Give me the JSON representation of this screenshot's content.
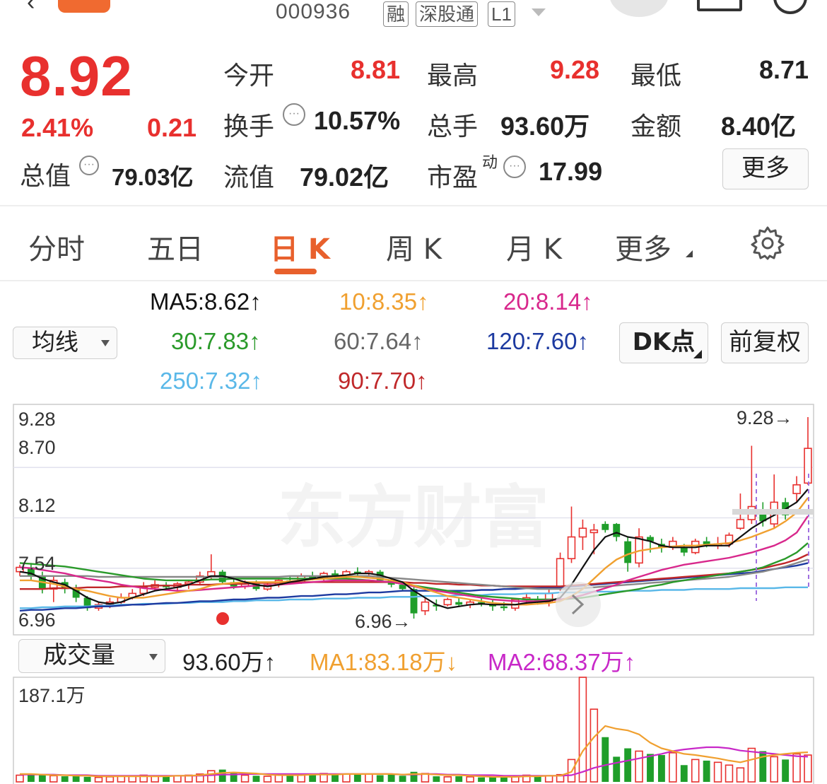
{
  "header": {
    "code": "000936",
    "tags": [
      "融",
      "深股通",
      "L1"
    ]
  },
  "quote": {
    "price": "8.92",
    "change_pct": "2.41%",
    "change_amt": "0.21",
    "total_value_label": "总值",
    "total_value": "79.03亿",
    "rows": [
      [
        {
          "label": "今开",
          "value": "8.81",
          "color": "red"
        },
        {
          "label": "最高",
          "value": "9.28",
          "color": "red"
        },
        {
          "label": "最低",
          "value": "8.71",
          "color": "black"
        }
      ],
      [
        {
          "label": "换手",
          "value": "10.57%",
          "color": "black"
        },
        {
          "label": "总手",
          "value": "93.60万",
          "color": "black"
        },
        {
          "label": "金额",
          "value": "8.40亿",
          "color": "black"
        }
      ],
      [
        {
          "label": "流值",
          "value": "79.02亿",
          "color": "black"
        },
        {
          "label": "市盈",
          "sup": "动",
          "value": "17.99",
          "color": "black"
        }
      ]
    ],
    "more_button": "更多"
  },
  "tabs": [
    "分时",
    "五日",
    "日 K",
    "周 K",
    "月 K",
    "更多"
  ],
  "active_tab": 2,
  "ma_controls": {
    "selector": "均线",
    "dk_button": "DK点",
    "adjust_button": "前复权",
    "items": [
      {
        "text": "MA5:8.62",
        "arrow": "↑",
        "color": "#111111"
      },
      {
        "text": "10:8.35",
        "arrow": "↑",
        "color": "#f0a030"
      },
      {
        "text": "20:8.14",
        "arrow": "↑",
        "color": "#d8288c"
      },
      {
        "text": "30:7.83",
        "arrow": "↑",
        "color": "#2a9a2a"
      },
      {
        "text": "60:7.64",
        "arrow": "↑",
        "color": "#666666"
      },
      {
        "text": "120:7.60",
        "arrow": "↑",
        "color": "#1d3aa0"
      },
      {
        "text": "250:7.32",
        "arrow": "↑",
        "color": "#5ab8e8"
      },
      {
        "text": "90:7.70",
        "arrow": "↑",
        "color": "#c0282a"
      }
    ]
  },
  "kline": {
    "y_labels": [
      "9.28",
      "8.70",
      "8.12",
      "7.54",
      "6.96"
    ],
    "max_annotation": "9.28→",
    "min_annotation": "6.96→",
    "watermark": "东方财富"
  },
  "volume": {
    "selector": "成交量",
    "current": "93.60万",
    "current_arrow": "↑",
    "ma1": "MA1:83.18万",
    "ma1_arrow": "↓",
    "ma2": "MA2:68.37万",
    "ma2_arrow": "↑",
    "max_label": "187.1万",
    "colors": {
      "ma1": "#f0a030",
      "ma2": "#c828c8"
    }
  },
  "chart_data": {
    "type": "candlestick",
    "y_range": [
      6.96,
      9.28
    ],
    "candles": [
      [
        7.5,
        7.58,
        7.45,
        7.55
      ],
      [
        7.55,
        7.6,
        7.4,
        7.45
      ],
      [
        7.45,
        7.5,
        7.25,
        7.3
      ],
      [
        7.3,
        7.45,
        7.15,
        7.4
      ],
      [
        7.38,
        7.42,
        7.25,
        7.3
      ],
      [
        7.3,
        7.35,
        7.15,
        7.2
      ],
      [
        7.2,
        7.22,
        7.05,
        7.08
      ],
      [
        7.08,
        7.15,
        7.05,
        7.12
      ],
      [
        7.12,
        7.2,
        7.08,
        7.15
      ],
      [
        7.15,
        7.25,
        7.12,
        7.2
      ],
      [
        7.2,
        7.3,
        7.18,
        7.25
      ],
      [
        7.25,
        7.38,
        7.22,
        7.32
      ],
      [
        7.32,
        7.4,
        7.28,
        7.35
      ],
      [
        7.35,
        7.38,
        7.3,
        7.32
      ],
      [
        7.32,
        7.38,
        7.28,
        7.36
      ],
      [
        7.36,
        7.4,
        7.3,
        7.38
      ],
      [
        7.38,
        7.5,
        7.35,
        7.45
      ],
      [
        7.45,
        7.7,
        7.42,
        7.5
      ],
      [
        7.5,
        7.52,
        7.35,
        7.38
      ],
      [
        7.38,
        7.42,
        7.3,
        7.33
      ],
      [
        7.33,
        7.4,
        7.3,
        7.36
      ],
      [
        7.36,
        7.4,
        7.28,
        7.3
      ],
      [
        7.3,
        7.38,
        7.28,
        7.35
      ],
      [
        7.35,
        7.42,
        7.32,
        7.4
      ],
      [
        7.4,
        7.45,
        7.35,
        7.38
      ],
      [
        7.38,
        7.48,
        7.36,
        7.45
      ],
      [
        7.45,
        7.5,
        7.4,
        7.42
      ],
      [
        7.42,
        7.5,
        7.4,
        7.48
      ],
      [
        7.48,
        7.52,
        7.42,
        7.45
      ],
      [
        7.45,
        7.52,
        7.42,
        7.5
      ],
      [
        7.5,
        7.55,
        7.45,
        7.48
      ],
      [
        7.48,
        7.52,
        7.45,
        7.5
      ],
      [
        7.5,
        7.52,
        7.38,
        7.4
      ],
      [
        7.4,
        7.42,
        7.32,
        7.35
      ],
      [
        7.35,
        7.38,
        7.28,
        7.3
      ],
      [
        7.3,
        7.32,
        6.96,
        7.02
      ],
      [
        7.05,
        7.2,
        7.0,
        7.15
      ],
      [
        7.12,
        7.18,
        7.05,
        7.1
      ],
      [
        7.12,
        7.2,
        7.1,
        7.18
      ],
      [
        7.15,
        7.2,
        7.1,
        7.12
      ],
      [
        7.12,
        7.18,
        7.08,
        7.15
      ],
      [
        7.15,
        7.2,
        7.1,
        7.12
      ],
      [
        7.12,
        7.18,
        7.05,
        7.1
      ],
      [
        7.1,
        7.15,
        7.05,
        7.08
      ],
      [
        7.08,
        7.2,
        7.05,
        7.18
      ],
      [
        7.18,
        7.25,
        7.12,
        7.2
      ],
      [
        7.18,
        7.22,
        7.12,
        7.15
      ],
      [
        7.15,
        7.3,
        7.1,
        7.25
      ],
      [
        7.3,
        7.72,
        7.28,
        7.65
      ],
      [
        7.65,
        8.25,
        7.6,
        7.9
      ],
      [
        7.9,
        8.1,
        7.75,
        8.0
      ],
      [
        7.95,
        8.05,
        7.7,
        7.98
      ],
      [
        8.05,
        8.08,
        7.95,
        7.98
      ],
      [
        8.05,
        8.06,
        7.85,
        7.9
      ],
      [
        7.85,
        7.9,
        7.5,
        7.6
      ],
      [
        7.6,
        8.0,
        7.55,
        7.9
      ],
      [
        7.9,
        7.92,
        7.72,
        7.85
      ],
      [
        7.82,
        7.88,
        7.72,
        7.78
      ],
      [
        7.78,
        7.9,
        7.75,
        7.85
      ],
      [
        7.78,
        7.82,
        7.68,
        7.72
      ],
      [
        7.72,
        7.88,
        7.7,
        7.85
      ],
      [
        7.85,
        7.9,
        7.78,
        7.8
      ],
      [
        7.8,
        7.9,
        7.76,
        7.82
      ],
      [
        7.82,
        7.95,
        7.78,
        7.92
      ],
      [
        8.0,
        8.4,
        7.98,
        8.1
      ],
      [
        8.1,
        8.95,
        8.05,
        8.25
      ],
      [
        8.18,
        8.3,
        8.02,
        8.08
      ],
      [
        8.05,
        8.62,
        8.0,
        8.3
      ],
      [
        8.3,
        8.35,
        8.1,
        8.15
      ],
      [
        8.4,
        8.6,
        8.3,
        8.5
      ],
      [
        8.52,
        9.28,
        8.5,
        8.92
      ]
    ],
    "ma5": [
      7.5,
      7.48,
      7.42,
      7.38,
      7.35,
      7.28,
      7.2,
      7.15,
      7.13,
      7.15,
      7.2,
      7.24,
      7.28,
      7.3,
      7.32,
      7.35,
      7.4,
      7.45,
      7.45,
      7.42,
      7.38,
      7.35,
      7.33,
      7.35,
      7.38,
      7.4,
      7.42,
      7.44,
      7.45,
      7.46,
      7.48,
      7.48,
      7.46,
      7.42,
      7.38,
      7.28,
      7.2,
      7.12,
      7.08,
      7.1,
      7.12,
      7.13,
      7.12,
      7.12,
      7.12,
      7.14,
      7.15,
      7.16,
      7.2,
      7.35,
      7.55,
      7.75,
      7.9,
      7.95,
      7.9,
      7.88,
      7.85,
      7.8,
      7.78,
      7.78,
      7.78,
      7.8,
      7.8,
      7.8,
      7.9,
      8.0,
      8.08,
      8.15,
      8.22,
      8.3,
      8.45
    ],
    "ma10": [
      7.4,
      7.4,
      7.38,
      7.36,
      7.33,
      7.3,
      7.28,
      7.25,
      7.22,
      7.2,
      7.2,
      7.2,
      7.22,
      7.24,
      7.26,
      7.28,
      7.3,
      7.34,
      7.36,
      7.37,
      7.38,
      7.38,
      7.38,
      7.38,
      7.39,
      7.4,
      7.41,
      7.42,
      7.43,
      7.44,
      7.44,
      7.43,
      7.42,
      7.4,
      7.38,
      7.34,
      7.3,
      7.26,
      7.22,
      7.2,
      7.18,
      7.16,
      7.14,
      7.13,
      7.12,
      7.12,
      7.13,
      7.14,
      7.16,
      7.22,
      7.3,
      7.42,
      7.54,
      7.64,
      7.7,
      7.74,
      7.76,
      7.78,
      7.79,
      7.8,
      7.8,
      7.81,
      7.82,
      7.83,
      7.86,
      7.9,
      7.95,
      8.0,
      8.08,
      8.18,
      8.35
    ],
    "ma20": [
      7.55,
      7.54,
      7.52,
      7.5,
      7.48,
      7.45,
      7.42,
      7.4,
      7.38,
      7.35,
      7.33,
      7.31,
      7.3,
      7.29,
      7.28,
      7.28,
      7.29,
      7.3,
      7.31,
      7.32,
      7.33,
      7.34,
      7.34,
      7.35,
      7.36,
      7.37,
      7.38,
      7.39,
      7.4,
      7.4,
      7.4,
      7.4,
      7.39,
      7.38,
      7.36,
      7.33,
      7.3,
      7.28,
      7.26,
      7.24,
      7.22,
      7.2,
      7.18,
      7.17,
      7.16,
      7.16,
      7.16,
      7.17,
      7.18,
      7.2,
      7.23,
      7.27,
      7.31,
      7.35,
      7.4,
      7.44,
      7.48,
      7.52,
      7.55,
      7.58,
      7.6,
      7.62,
      7.64,
      7.66,
      7.69,
      7.72,
      7.76,
      7.8,
      7.86,
      7.95,
      8.14
    ],
    "ma30": [
      7.6,
      7.59,
      7.58,
      7.57,
      7.56,
      7.54,
      7.52,
      7.5,
      7.48,
      7.46,
      7.44,
      7.42,
      7.41,
      7.4,
      7.4,
      7.4,
      7.4,
      7.41,
      7.41,
      7.42,
      7.42,
      7.42,
      7.42,
      7.42,
      7.42,
      7.42,
      7.42,
      7.42,
      7.42,
      7.42,
      7.41,
      7.4,
      7.39,
      7.38,
      7.36,
      7.34,
      7.32,
      7.3,
      7.28,
      7.26,
      7.24,
      7.22,
      7.21,
      7.2,
      7.19,
      7.18,
      7.18,
      7.18,
      7.18,
      7.19,
      7.2,
      7.22,
      7.24,
      7.26,
      7.28,
      7.3,
      7.33,
      7.35,
      7.38,
      7.4,
      7.42,
      7.44,
      7.46,
      7.48,
      7.5,
      7.52,
      7.55,
      7.6,
      7.65,
      7.72,
      7.83
    ],
    "ma60": [
      7.45,
      7.45,
      7.45,
      7.45,
      7.45,
      7.45,
      7.45,
      7.44,
      7.44,
      7.44,
      7.44,
      7.44,
      7.44,
      7.44,
      7.44,
      7.44,
      7.44,
      7.44,
      7.44,
      7.44,
      7.44,
      7.44,
      7.44,
      7.44,
      7.45,
      7.45,
      7.45,
      7.45,
      7.45,
      7.45,
      7.45,
      7.45,
      7.44,
      7.43,
      7.42,
      7.41,
      7.4,
      7.39,
      7.38,
      7.37,
      7.36,
      7.35,
      7.34,
      7.33,
      7.32,
      7.31,
      7.3,
      7.3,
      7.3,
      7.3,
      7.31,
      7.32,
      7.33,
      7.34,
      7.35,
      7.36,
      7.37,
      7.38,
      7.39,
      7.4,
      7.41,
      7.42,
      7.43,
      7.44,
      7.46,
      7.48,
      7.5,
      7.53,
      7.56,
      7.6,
      7.64
    ],
    "ma90": [
      7.3,
      7.3,
      7.3,
      7.31,
      7.31,
      7.31,
      7.32,
      7.32,
      7.32,
      7.33,
      7.33,
      7.33,
      7.34,
      7.34,
      7.34,
      7.35,
      7.35,
      7.35,
      7.36,
      7.36,
      7.36,
      7.37,
      7.37,
      7.37,
      7.38,
      7.38,
      7.38,
      7.38,
      7.38,
      7.38,
      7.38,
      7.38,
      7.38,
      7.38,
      7.38,
      7.37,
      7.37,
      7.36,
      7.36,
      7.35,
      7.35,
      7.34,
      7.34,
      7.33,
      7.33,
      7.33,
      7.33,
      7.33,
      7.33,
      7.34,
      7.35,
      7.36,
      7.37,
      7.38,
      7.39,
      7.4,
      7.41,
      7.42,
      7.43,
      7.44,
      7.45,
      7.46,
      7.47,
      7.48,
      7.5,
      7.52,
      7.54,
      7.57,
      7.6,
      7.64,
      7.7
    ],
    "ma120": [
      7.05,
      7.06,
      7.06,
      7.07,
      7.08,
      7.08,
      7.09,
      7.1,
      7.1,
      7.11,
      7.12,
      7.12,
      7.13,
      7.14,
      7.14,
      7.15,
      7.16,
      7.16,
      7.17,
      7.18,
      7.18,
      7.19,
      7.2,
      7.2,
      7.21,
      7.22,
      7.22,
      7.23,
      7.24,
      7.24,
      7.25,
      7.26,
      7.26,
      7.27,
      7.28,
      7.28,
      7.28,
      7.28,
      7.28,
      7.28,
      7.28,
      7.29,
      7.29,
      7.3,
      7.3,
      7.31,
      7.31,
      7.32,
      7.32,
      7.33,
      7.34,
      7.35,
      7.36,
      7.37,
      7.38,
      7.39,
      7.4,
      7.41,
      7.42,
      7.43,
      7.44,
      7.45,
      7.46,
      7.47,
      7.48,
      7.49,
      7.51,
      7.53,
      7.55,
      7.57,
      7.6
    ],
    "ma250": [
      7.08,
      7.08,
      7.09,
      7.09,
      7.1,
      7.1,
      7.1,
      7.11,
      7.11,
      7.12,
      7.12,
      7.13,
      7.13,
      7.13,
      7.14,
      7.14,
      7.15,
      7.15,
      7.15,
      7.16,
      7.16,
      7.17,
      7.17,
      7.17,
      7.18,
      7.18,
      7.18,
      7.19,
      7.19,
      7.19,
      7.2,
      7.2,
      7.2,
      7.21,
      7.21,
      7.21,
      7.22,
      7.22,
      7.22,
      7.23,
      7.23,
      7.23,
      7.24,
      7.24,
      7.24,
      7.25,
      7.25,
      7.25,
      7.26,
      7.26,
      7.26,
      7.27,
      7.27,
      7.27,
      7.28,
      7.28,
      7.28,
      7.29,
      7.29,
      7.29,
      7.3,
      7.3,
      7.3,
      7.3,
      7.31,
      7.31,
      7.31,
      7.31,
      7.32,
      7.32,
      7.32
    ],
    "volume": [
      12,
      14,
      13,
      11,
      10,
      12,
      9,
      8,
      9,
      10,
      11,
      12,
      10,
      9,
      11,
      12,
      14,
      20,
      22,
      16,
      12,
      11,
      10,
      12,
      13,
      12,
      14,
      15,
      13,
      14,
      15,
      14,
      12,
      13,
      11,
      18,
      15,
      10,
      9,
      10,
      9,
      8,
      9,
      10,
      11,
      12,
      10,
      11,
      13,
      40,
      187,
      130,
      80,
      45,
      60,
      55,
      50,
      48,
      52,
      30,
      40,
      38,
      35,
      30,
      25,
      60,
      55,
      45,
      40,
      50,
      48
    ],
    "volume_ma1": [
      14,
      14,
      13,
      12,
      12,
      11,
      11,
      10,
      10,
      10,
      10,
      10,
      10,
      10,
      11,
      11,
      12,
      14,
      16,
      17,
      16,
      15,
      13,
      12,
      12,
      12,
      13,
      13,
      13,
      14,
      14,
      14,
      14,
      14,
      13,
      14,
      14,
      13,
      12,
      12,
      11,
      10,
      9,
      9,
      9,
      10,
      10,
      11,
      11,
      18,
      55,
      80,
      100,
      95,
      92,
      85,
      70,
      60,
      55,
      50,
      48,
      45,
      42,
      38,
      35,
      40,
      45,
      48,
      50,
      52,
      53
    ],
    "volume_ma2": [
      13,
      13,
      13,
      13,
      12,
      12,
      12,
      11,
      11,
      11,
      11,
      11,
      11,
      11,
      11,
      11,
      11,
      12,
      13,
      13,
      14,
      14,
      14,
      14,
      14,
      14,
      14,
      14,
      14,
      14,
      14,
      14,
      14,
      14,
      13,
      13,
      14,
      14,
      13,
      13,
      12,
      12,
      12,
      11,
      11,
      11,
      11,
      11,
      11,
      12,
      18,
      25,
      30,
      34,
      38,
      42,
      46,
      50,
      55,
      58,
      60,
      62,
      62,
      60,
      56,
      54,
      52,
      50,
      48,
      46,
      45
    ]
  }
}
